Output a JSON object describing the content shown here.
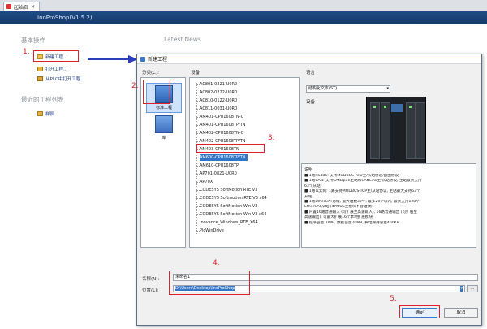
{
  "tab": {
    "label": "起始页"
  },
  "banner": {
    "title": "InoProShop(V1.5.2)"
  },
  "basic_ops": {
    "heading": "基本操作",
    "items": [
      "新建工程...",
      "打开工程...",
      "从PLC中打开工程..."
    ]
  },
  "recent": {
    "heading": "最近的工程列表",
    "items": [
      "样例"
    ]
  },
  "news": {
    "heading": "Latest News"
  },
  "dialog": {
    "title": "新建工程",
    "category_label": "分类(C):",
    "categories": [
      "标准工程",
      "库"
    ],
    "device_label": "设备",
    "devices": [
      "AC801-0221-U0R0",
      "AC802-0222-U0R0",
      "AC810-0122-U0R0",
      "AC811-0031-U0R0",
      "AM401-CPU1608TN-C",
      "AM401-CPU1608TP/TN",
      "AM402-CPU1608TN-C",
      "AM402-CPU1608TP/TN",
      "AM403-CPU1608TN",
      "AM600-CPU1608TP/TN",
      "AM610-CPU1608TP",
      "AP701-0821-U0R0",
      "AP70X",
      "CODESYS SoftMotion RTE V3",
      "CODESYS Softmotion RTE V3 x64",
      "CODESYS SoftMotion Win V3",
      "CODESYS SoftMotion Win V3 x64",
      "Inovance_Windows_RTE_X64",
      "PlcWinDrive"
    ],
    "selected_device_index": 9,
    "language_label": "语言",
    "language_value": "结构化文本(ST)",
    "device_image_label": "设备",
    "description_label": "说明",
    "description_lines": [
      "■ 1路RS485: 支持MODBUS-RTU主/从站协议/自由协议",
      "■ 1路CAN: 支持CANopen主站和CANLink主/从站协议, 主站最大支持",
      "  63个从站",
      "■ 1路以太网: 1路支持MODBUS-TCP主/从站协议, 主站最大支持63个",
      "  从站",
      "■ 1路EtherCAT总线, 最大轴数32个, 最多20个以内, 最大支持128个",
      "  EtherCAT从站 (4PMOS主模块不含轴数)",
      "■ 内置16路普通输入 (可扩展至高速输入), 16路普通输出 (可扩展至",
      "  高速输出), 可最大扩展16个本地扩展模块",
      "■ 程序容量10MB, 数据容量20MB, 掉电保持容量400KB"
    ],
    "name_label": "名称(N):",
    "name_value": "未命名1",
    "location_label": "位置(L):",
    "location_value": "D:\\Users\\Desktop\\InoProShop",
    "ok_label": "确定",
    "cancel_label": "取消"
  },
  "annotations": [
    "1.",
    "2.",
    "3.",
    "4.",
    "5."
  ],
  "colors": {
    "banner": "#1e4c86",
    "annotation": "#e0202a",
    "selection": "#3276c8"
  }
}
